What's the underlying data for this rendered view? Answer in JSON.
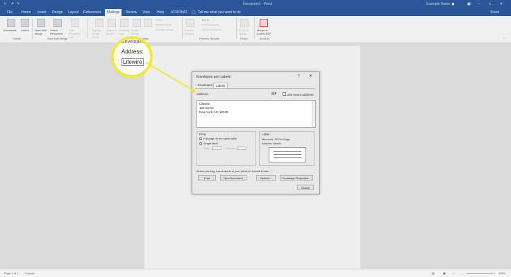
{
  "window": {
    "title": "Document1 - Word",
    "user": "Example Name",
    "share": "Share"
  },
  "menu": {
    "items": [
      "File",
      "Home",
      "Insert",
      "Design",
      "Layout",
      "References",
      "Mailings",
      "Review",
      "View",
      "Help",
      "ACROBAT"
    ],
    "active": "Mailings",
    "tell_me": "Tell me what you want to do"
  },
  "ribbon": {
    "create": {
      "envelopes": "Envelopes",
      "labels": "Labels",
      "group": "Create"
    },
    "start": {
      "start_mail_merge": "Start Mail Merge",
      "select_recipients": "Select Recipients",
      "edit_list": "Edit Recipient List",
      "group": "Start Mail Merge"
    },
    "write": {
      "highlight": "Highlight Merge Fields",
      "address_block": "Address Block",
      "greeting": "Greeting Line",
      "insert_field": "Insert Merge Field",
      "rules": "Rules",
      "match": "Match Fields",
      "update": "Update Labels",
      "group": "Write & Insert Fields"
    },
    "preview": {
      "preview_results": "Preview Results",
      "find": "Find Recipient",
      "check": "Check for Errors",
      "group": "Preview Results"
    },
    "finish": {
      "finish_merge": "Finish & Merge",
      "group": "Finish"
    },
    "acrobat": {
      "merge_pdf": "Merge to Adobe PDF",
      "group": "Acrobat"
    }
  },
  "magnifier": {
    "envelopes": "Envelopes",
    "address": "Address:",
    "lifewire": "Lifewire"
  },
  "dialog": {
    "title": "Envelopes and Labels",
    "help": "?",
    "close": "✕",
    "tabs": [
      "Envelopes",
      "Labels"
    ],
    "active_tab": "Labels",
    "address_label": "Address:",
    "use_return_address": "Use return address",
    "address_lines": [
      "Lifewire",
      "123 Street",
      "New York, NY 12345"
    ],
    "print": {
      "heading": "Print",
      "full_page": "Full page of the same label",
      "single": "Single label",
      "row_label": "Row:",
      "row_value": "1",
      "column_label": "Column:",
      "column_value": "1"
    },
    "label": {
      "heading": "Label",
      "vendor": "Microsoft, 30 Per Page",
      "type": "Address Labels"
    },
    "note": "Before printing, insert labels in your printer's manual feeder.",
    "buttons": {
      "print": "Print",
      "new_document": "New Document",
      "options": "Options...",
      "e_postage": "E-postage Properties...",
      "cancel": "Cancel"
    }
  },
  "status": {
    "page": "Page 1 of 1",
    "words": "0 words",
    "zoom": "100%"
  },
  "colors": {
    "brand": "#2b579a",
    "highlight": "#efea3a"
  }
}
